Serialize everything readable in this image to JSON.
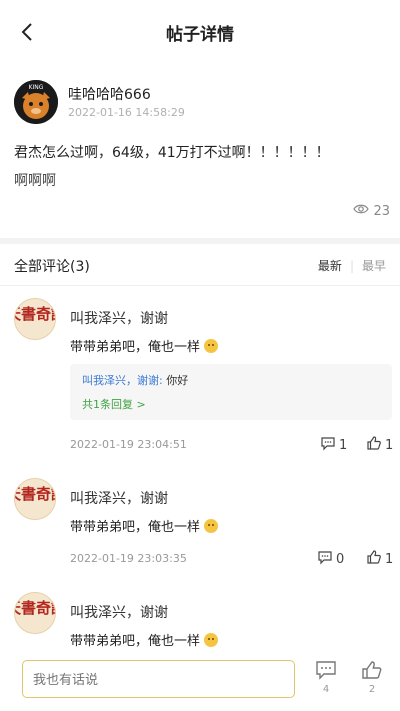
{
  "header": {
    "title": "帖子详情"
  },
  "post": {
    "author": "哇哈哈哈666",
    "time": "2022-01-16 14:58:29",
    "text_line1": "君杰怎么过啊，64级，41万打不过啊！！！！！！",
    "text_line2": "啊啊啊",
    "views": "23",
    "avatar_label": "KING"
  },
  "comments_header": {
    "title": "全部评论(3)",
    "sort_latest": "最新",
    "sort_earliest": "最早"
  },
  "comments": [
    {
      "name": "叫我泽兴，谢谢",
      "text": "带带弟弟吧，俺也一样",
      "reply": {
        "author": "叫我泽兴，谢谢:",
        "text": "你好",
        "more": "共1条回复 >"
      },
      "time": "2022-01-19 23:04:51",
      "replies": "1",
      "likes": "1",
      "avatar_text": "天書奇譚"
    },
    {
      "name": "叫我泽兴，谢谢",
      "text": "带带弟弟吧，俺也一样",
      "time": "2022-01-19 23:03:35",
      "replies": "0",
      "likes": "1",
      "avatar_text": "天書奇譚"
    },
    {
      "name": "叫我泽兴，谢谢",
      "text": "带带弟弟吧，俺也一样",
      "avatar_text": "天書奇譚"
    }
  ],
  "bottom": {
    "placeholder": "我也有话说",
    "comments_count": "4",
    "likes_count": "2"
  },
  "colors": {
    "accent_green": "#3fa343",
    "link_blue": "#3a7bd5",
    "input_border": "#e0c66a"
  }
}
